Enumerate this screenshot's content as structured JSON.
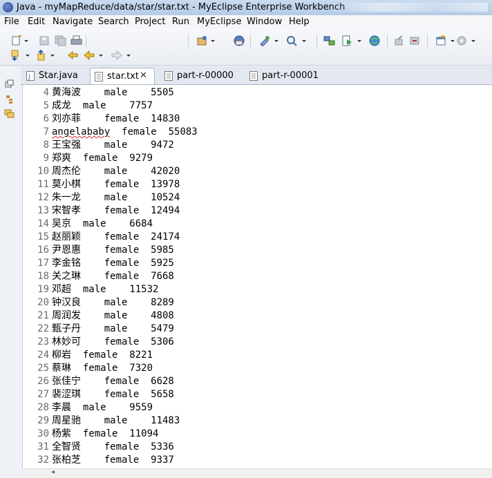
{
  "window": {
    "title": "Java - myMapReduce/data/star/star.txt - MyEclipse Enterprise Workbench"
  },
  "menu": [
    "File",
    "Edit",
    "Navigate",
    "Search",
    "Project",
    "Run",
    "MyEclipse",
    "Window",
    "Help"
  ],
  "toolbar": {
    "row1": [
      "new-wizard-icon",
      "dropdown-icon",
      "save-icon",
      "save-all-icon",
      "print-icon",
      "new-java-project-icon",
      "dropdown-icon",
      "java-server-icon",
      "open-type-icon",
      "dropdown-icon",
      "search-icon",
      "dropdown-icon",
      "open-web-browser-icon",
      "run-icon",
      "dropdown-icon",
      "globe-icon",
      "external-tools-icon",
      "debug-server-icon",
      "new-window-icon",
      "dropdown-icon",
      "extension-icon",
      "dropdown-icon"
    ],
    "row2": [
      "next-annotation-icon",
      "dropdown-icon",
      "prev-annotation-icon",
      "dropdown-icon",
      "last-edit-icon",
      "back-icon",
      "dropdown-icon",
      "forward-icon",
      "dropdown-icon"
    ]
  },
  "left_trim": [
    "restore-icon",
    "hierarchy-icon",
    "package-explorer-icon"
  ],
  "tabs": [
    {
      "label": "Star.java",
      "icon": "java-file-icon",
      "active": false
    },
    {
      "label": "star.txt",
      "icon": "text-file-icon",
      "active": true,
      "close": "✕"
    },
    {
      "label": "part-r-00000",
      "icon": "text-file-icon",
      "active": false
    },
    {
      "label": "part-r-00001",
      "icon": "text-file-icon",
      "active": false
    }
  ],
  "editor": {
    "lines": [
      {
        "n": "4",
        "text": "黄海波    male    5505"
      },
      {
        "n": "5",
        "text": "成龙  male    7757"
      },
      {
        "n": "6",
        "text": "刘亦菲    female  14830"
      },
      {
        "n": "7",
        "text": "angelababy  female  55083",
        "squiggle": "angelababy"
      },
      {
        "n": "8",
        "text": "王宝强    male    9472"
      },
      {
        "n": "9",
        "text": "郑爽  female  9279"
      },
      {
        "n": "10",
        "text": "周杰伦    male    42020"
      },
      {
        "n": "11",
        "text": "莫小棋    female  13978"
      },
      {
        "n": "12",
        "text": "朱一龙    male    10524"
      },
      {
        "n": "13",
        "text": "宋智孝    female  12494"
      },
      {
        "n": "14",
        "text": "吴京  male    6684"
      },
      {
        "n": "15",
        "text": "赵丽颖    female  24174"
      },
      {
        "n": "16",
        "text": "尹恩惠    female  5985"
      },
      {
        "n": "17",
        "text": "李金铭    female  5925"
      },
      {
        "n": "18",
        "text": "关之琳    female  7668"
      },
      {
        "n": "19",
        "text": "邓超  male    11532"
      },
      {
        "n": "20",
        "text": "钟汉良    male    8289"
      },
      {
        "n": "21",
        "text": "周润发    male    4808"
      },
      {
        "n": "22",
        "text": "甄子丹    male    5479"
      },
      {
        "n": "23",
        "text": "林妙可    female  5306"
      },
      {
        "n": "24",
        "text": "柳岩  female  8221"
      },
      {
        "n": "25",
        "text": "蔡琳  female  7320"
      },
      {
        "n": "26",
        "text": "张佳宁    female  6628"
      },
      {
        "n": "27",
        "text": "裴涩琪    female  5658"
      },
      {
        "n": "28",
        "text": "李晨  male    9559"
      },
      {
        "n": "29",
        "text": "周星驰    male    11483"
      },
      {
        "n": "30",
        "text": "杨紫  female  11094"
      },
      {
        "n": "31",
        "text": "全智贤    female  5336"
      },
      {
        "n": "32",
        "text": "张柏芝    female  9337"
      }
    ]
  },
  "colors": {
    "title_bar": "#c9dbef",
    "editor_bg": "#ffffff",
    "line_number": "#6a6a6a",
    "spell_error": "#d62a2a"
  }
}
